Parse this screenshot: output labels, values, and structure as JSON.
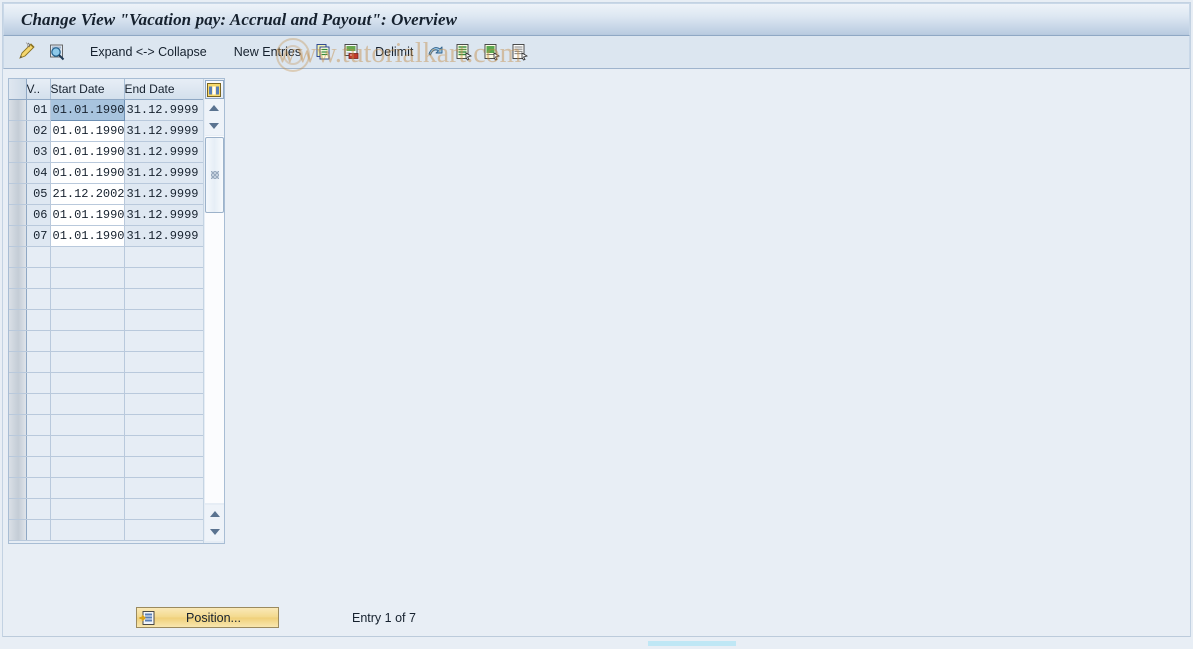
{
  "window": {
    "title": "Change View \"Vacation pay: Accrual and Payout\": Overview"
  },
  "toolbar": {
    "items": [
      {
        "name": "display-change-icon",
        "label": "",
        "icon": "pencil-display-change-icon"
      },
      {
        "name": "check-entries-icon",
        "label": "",
        "icon": "magnifier-check-icon"
      },
      {
        "name": "expand-collapse",
        "label": "Expand <-> Collapse",
        "icon": ""
      },
      {
        "name": "new-entries",
        "label": "New Entries",
        "icon": ""
      },
      {
        "name": "copy-as",
        "label": "",
        "icon": "copy-icon"
      },
      {
        "name": "delete",
        "label": "",
        "icon": "cut-paste-icon"
      },
      {
        "name": "delimit",
        "label": "Delimit",
        "icon": ""
      },
      {
        "name": "delimit-arrow",
        "label": "",
        "icon": "delimit-arrow-icon"
      },
      {
        "name": "select-block",
        "label": "",
        "icon": "document-select-icon"
      },
      {
        "name": "select-all",
        "label": "",
        "icon": "document-green-icon"
      },
      {
        "name": "deselect-all",
        "label": "",
        "icon": "document-plain-icon"
      }
    ],
    "watermark": "www.tutorialkart.com"
  },
  "table": {
    "columns": [
      {
        "key": "sel",
        "label": ""
      },
      {
        "key": "v",
        "label": "V.."
      },
      {
        "key": "start_date",
        "label": "Start Date"
      },
      {
        "key": "end_date",
        "label": "End Date"
      }
    ],
    "rows": [
      {
        "v": "01",
        "start_date": "01.01.1990",
        "end_date": "31.12.9999",
        "selected": true
      },
      {
        "v": "02",
        "start_date": "01.01.1990",
        "end_date": "31.12.9999",
        "selected": false
      },
      {
        "v": "03",
        "start_date": "01.01.1990",
        "end_date": "31.12.9999",
        "selected": false
      },
      {
        "v": "04",
        "start_date": "01.01.1990",
        "end_date": "31.12.9999",
        "selected": false
      },
      {
        "v": "05",
        "start_date": "21.12.2002",
        "end_date": "31.12.9999",
        "selected": false
      },
      {
        "v": "06",
        "start_date": "01.01.1990",
        "end_date": "31.12.9999",
        "selected": false
      },
      {
        "v": "07",
        "start_date": "01.01.1990",
        "end_date": "31.12.9999",
        "selected": false
      }
    ],
    "empty_row_count": 14,
    "config_icon": "table-settings-icon"
  },
  "footer": {
    "position_button": "Position...",
    "position_icon": "position-icon",
    "entry_status": "Entry 1 of 7"
  },
  "colors": {
    "title_gradient_top": "#eef3f9",
    "title_gradient_bottom": "#b9cbe0",
    "background": "#e8eef5",
    "grid_background": "#e6edf5",
    "cell_fill": "#dfe8f2",
    "selection": "#a8c4de",
    "button_yellow": "#f3d98d",
    "watermark": "#c48c44",
    "bottom_strip": "#bfe7f5"
  }
}
